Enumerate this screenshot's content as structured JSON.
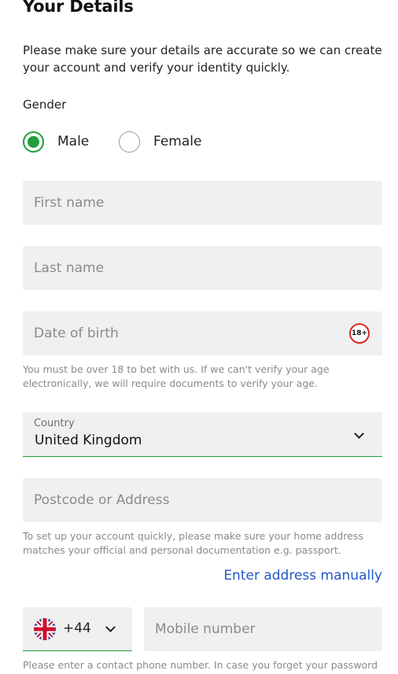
{
  "page": {
    "title": "Your Details",
    "intro": "Please make sure your details are accurate so we can create your account and verify your identity quickly."
  },
  "gender": {
    "label": "Gender",
    "options": [
      {
        "label": "Male",
        "selected": true
      },
      {
        "label": "Female",
        "selected": false
      }
    ]
  },
  "fields": {
    "first_name": {
      "placeholder": "First name",
      "value": ""
    },
    "last_name": {
      "placeholder": "Last name",
      "value": ""
    },
    "dob": {
      "placeholder": "Date of birth",
      "value": "",
      "badge": "18+"
    },
    "dob_help": "You must be over 18 to bet with us. If we can't verify your age electronically, we will require documents to verify your age.",
    "country": {
      "caption": "Country",
      "value": "United Kingdom"
    },
    "address": {
      "placeholder": "Postcode or Address",
      "value": ""
    },
    "address_help": "To set up your account quickly, please make sure your home address matches your official and personal documentation e.g. passport.",
    "address_link": "Enter address manually",
    "phone_code": {
      "value": "+44",
      "flag_icon": "uk-flag-icon"
    },
    "mobile": {
      "placeholder": "Mobile number",
      "value": ""
    },
    "mobile_help": "Please enter a contact phone number. In case you forget your password"
  },
  "colors": {
    "accent_green": "#1f9e3c",
    "link_blue": "#2357c7",
    "field_bg": "#f0f0f0",
    "badge_red": "#d42a2a"
  }
}
